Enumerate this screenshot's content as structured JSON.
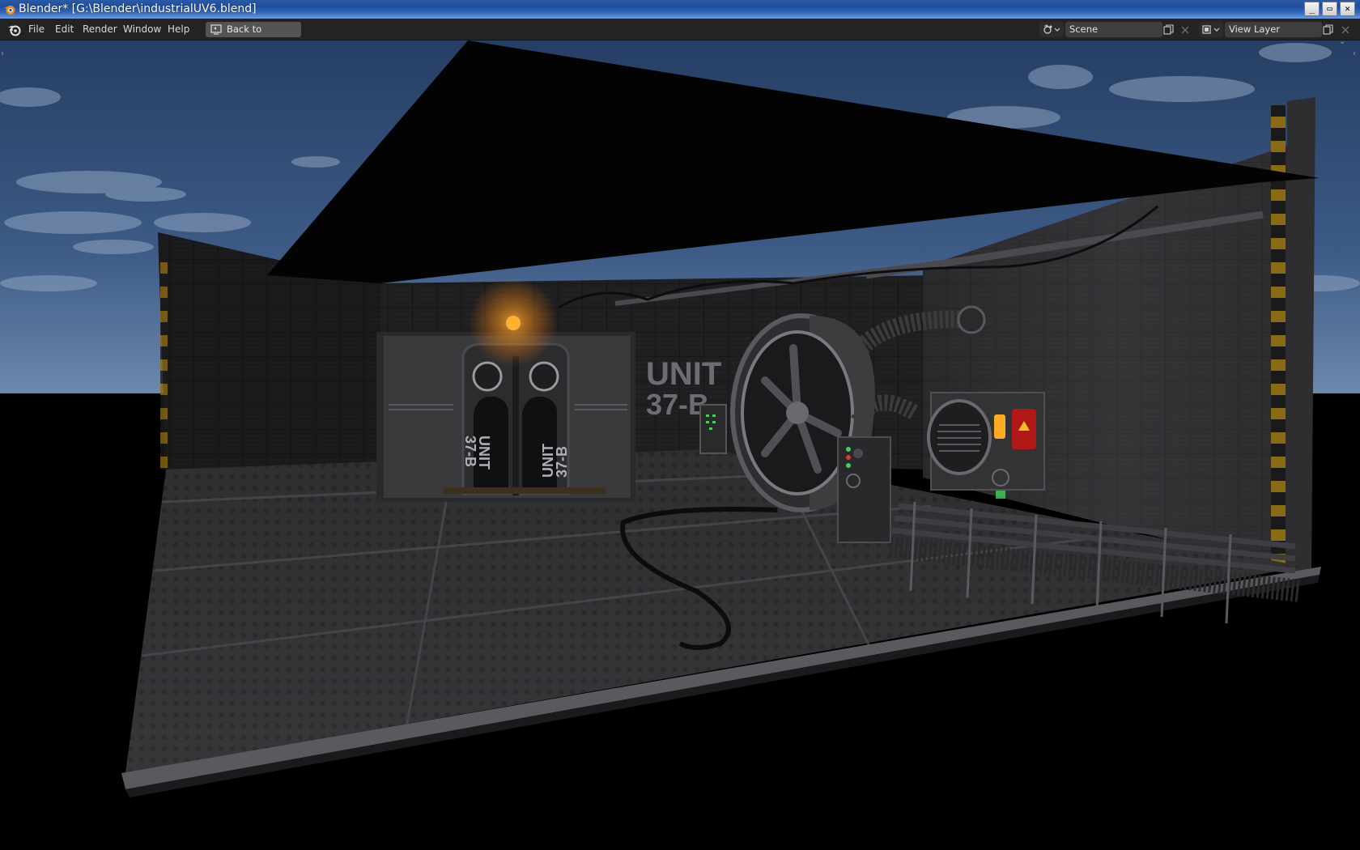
{
  "window": {
    "title": "Blender* [G:\\Blender\\industrialUV6.blend]",
    "buttons": {
      "minimize": "_",
      "maximize": "▭",
      "close": "✕"
    }
  },
  "menubar": {
    "items": [
      "File",
      "Edit",
      "Render",
      "Window",
      "Help"
    ],
    "back_button": "Back to Previous",
    "scene": {
      "label": "Scene"
    },
    "view_layer": {
      "label": "View Layer"
    }
  },
  "viewport": {
    "signs": {
      "wall_line1": "UNIT",
      "wall_line2": "37-B",
      "door_left_line1": "UNIT",
      "door_left_line2": "37-B",
      "door_right_line1": "UNIT",
      "door_right_line2": "37-B"
    }
  },
  "colors": {
    "titlebar": "#1e4d9c",
    "menubar": "#232323",
    "button": "#545454",
    "sky": "#3b5680",
    "amber_light": "#ffa020",
    "status_green": "#3cd25a",
    "warning_red": "#b01818"
  },
  "icons": {
    "app": "blender-icon",
    "back": "fullscreen-back-icon",
    "scene": "scene-icon",
    "view_layer": "render-layers-icon",
    "new": "duplicate-icon",
    "remove": "close-icon"
  }
}
